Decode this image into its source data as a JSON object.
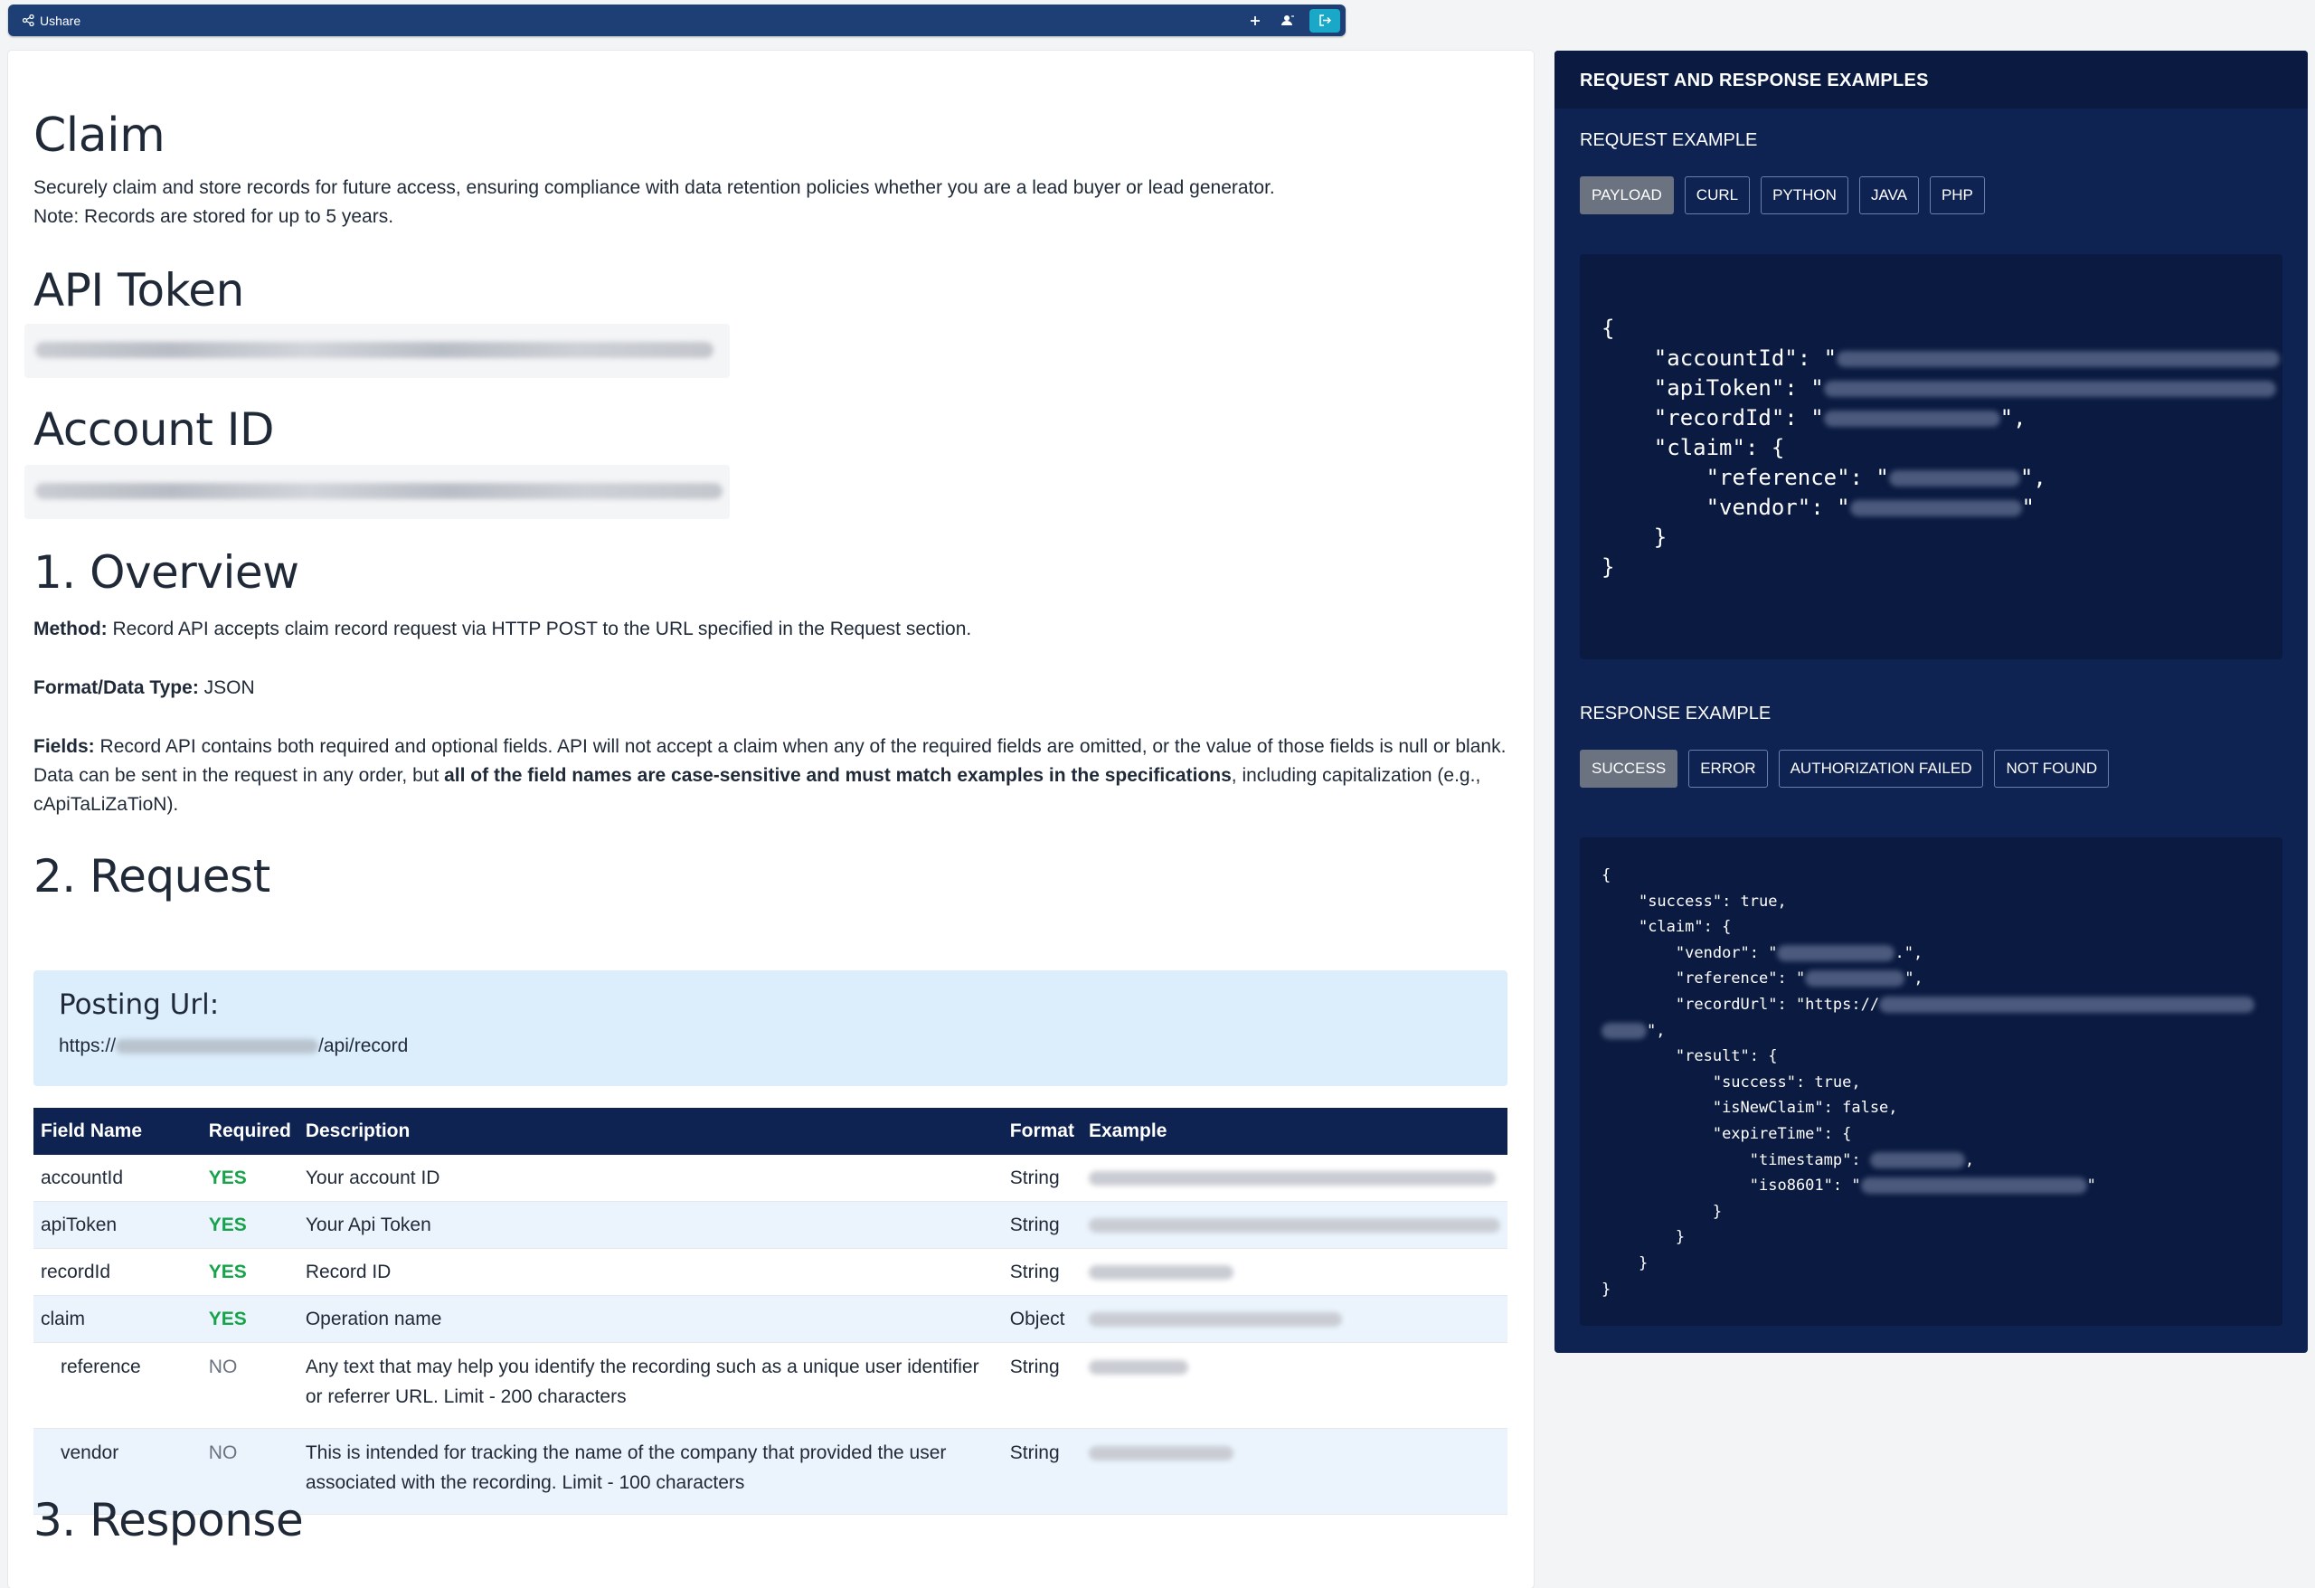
{
  "topbar": {
    "brand": "Ushare",
    "icons": [
      "share-icon",
      "plus-icon",
      "user-icon",
      "logout-icon"
    ]
  },
  "page": {
    "title": "Claim",
    "intro_line1": "Securely claim and store records for future access, ensuring compliance with data retention policies whether you are a lead buyer or lead generator.",
    "intro_line2": "Note: Records are stored for up to 5 years.",
    "api_token_heading": "API Token",
    "account_id_heading": "Account ID",
    "overview_heading": "1. Overview",
    "method_label": "Method:",
    "method_text": "Record API accepts claim record request via HTTP POST to the URL specified in the Request section.",
    "format_label": "Format/Data Type:",
    "format_text": "JSON",
    "fields_label": "Fields:",
    "fields_text1": "Record API contains both required and optional fields. API will not accept a claim when any of the required fields are omitted, or the value of those fields is null or blank.",
    "fields_text2a": "Data can be sent in the request in any order, but ",
    "fields_text2b": "all of the field names are case-sensitive and must match examples in the specifications",
    "fields_text2c": ", including capitalization (e.g.,",
    "fields_text3": "cApiTaLiZaTioN).",
    "request_heading": "2. Request",
    "posting_title": "Posting Url:",
    "posting_url_prefix": "https://",
    "posting_url_suffix": "/api/record",
    "response_heading": "3. Response"
  },
  "table": {
    "headers": [
      "Field Name",
      "Required",
      "Description",
      "Format",
      "Example"
    ],
    "rows": [
      {
        "field": "accountId",
        "required": "YES",
        "description": "Your account ID",
        "format": "String"
      },
      {
        "field": "apiToken",
        "required": "YES",
        "description": "Your Api Token",
        "format": "String"
      },
      {
        "field": "recordId",
        "required": "YES",
        "description": "Record ID",
        "format": "String"
      },
      {
        "field": "claim",
        "required": "YES",
        "description": "Operation name",
        "format": "Object"
      },
      {
        "field": "reference",
        "required": "NO",
        "description": "Any text that may help you identify the recording such as a unique user identifier or referrer URL. Limit - 200 characters",
        "format": "String"
      },
      {
        "field": "vendor",
        "required": "NO",
        "description": "This is intended for tracking the name of the company that provided the user associated with the recording. Limit - 100 characters",
        "format": "String"
      }
    ]
  },
  "side": {
    "title": "REQUEST AND RESPONSE EXAMPLES",
    "request_label": "REQUEST EXAMPLE",
    "request_tabs": [
      "PAYLOAD",
      "CURL",
      "PYTHON",
      "JAVA",
      "PHP"
    ],
    "request_active": "PAYLOAD",
    "response_label": "RESPONSE EXAMPLE",
    "response_tabs": [
      "SUCCESS",
      "ERROR",
      "AUTHORIZATION FAILED",
      "NOT FOUND"
    ],
    "response_active": "SUCCESS",
    "payload": {
      "open": "{",
      "k_account": "\"accountId\": \"",
      "k_token": "\"apiToken\": \"",
      "k_record": "\"recordId\": \"",
      "k_claim": "\"claim\": {",
      "k_reference": "\"reference\": \"",
      "k_vendor": "\"vendor\": \"",
      "close_inner": "}",
      "close": "}"
    },
    "response": {
      "open": "{",
      "success": "\"success\": true,",
      "claim": "\"claim\": {",
      "vendor": "\"vendor\": \"",
      "reference": "\"reference\": \"",
      "recordUrl": "\"recordUrl\": \"https://",
      "result": "\"result\": {",
      "r_success": "\"success\": true,",
      "isNewClaim": "\"isNewClaim\": false,",
      "expireTime": "\"expireTime\": {",
      "timestamp": "\"timestamp\":",
      "iso": "\"iso8601\": \"",
      "close": "}"
    }
  }
}
